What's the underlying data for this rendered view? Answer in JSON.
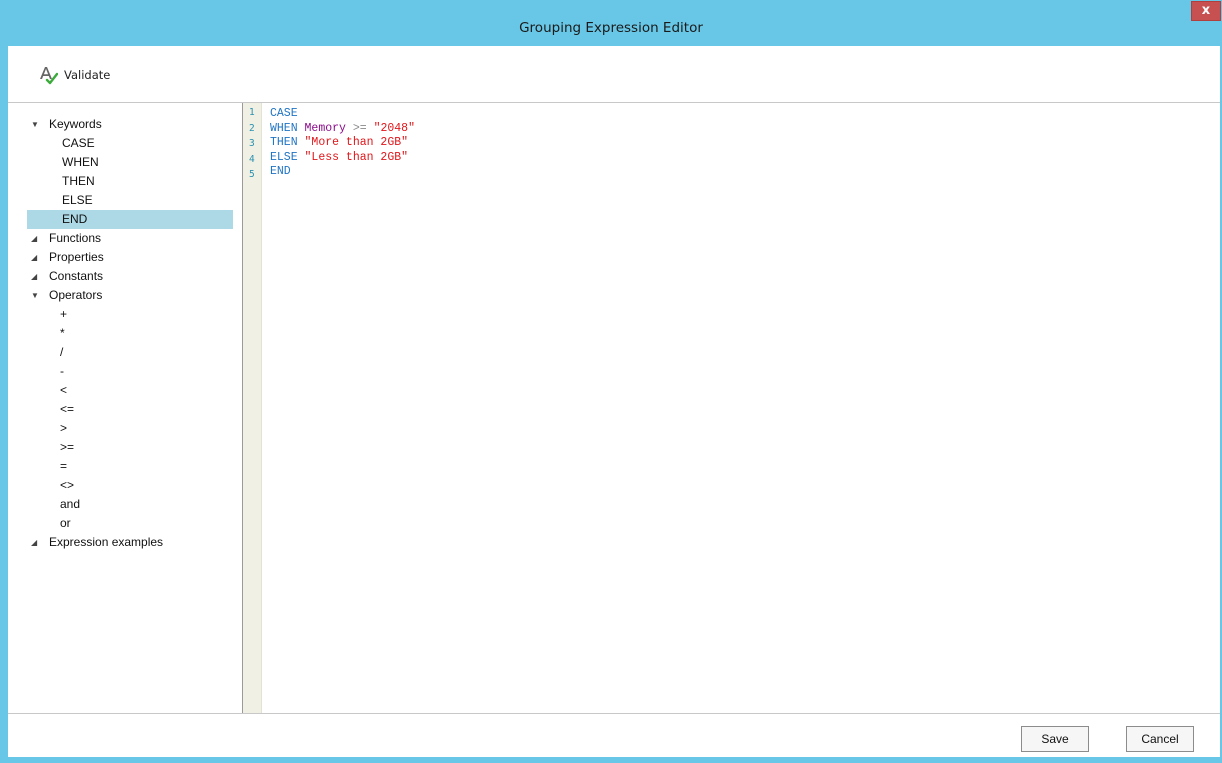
{
  "window": {
    "title": "Grouping Expression Editor",
    "close_glyph": "x"
  },
  "toolbar": {
    "validate_label": "Validate",
    "validate_icon": "spellcheck-icon"
  },
  "tree": {
    "categories": [
      {
        "label": "Keywords",
        "expanded": true,
        "items": [
          "CASE",
          "WHEN",
          "THEN",
          "ELSE",
          "END"
        ],
        "selected_item": "END"
      },
      {
        "label": "Functions",
        "expanded": false
      },
      {
        "label": "Properties",
        "expanded": false
      },
      {
        "label": "Constants",
        "expanded": false
      },
      {
        "label": "Operators",
        "expanded": true,
        "items": [
          "+",
          "*",
          "/",
          "-",
          "<",
          "<=",
          ">",
          ">=",
          "=",
          "<>",
          "and",
          "or"
        ]
      },
      {
        "label": "Expression examples",
        "expanded": false
      }
    ]
  },
  "editor": {
    "line_numbers": [
      "1",
      "2",
      "3",
      "4",
      "5"
    ],
    "lines": [
      [
        {
          "t": "CASE",
          "c": "kw"
        }
      ],
      [
        {
          "t": "WHEN",
          "c": "kw"
        },
        {
          "t": " "
        },
        {
          "t": "Memory",
          "c": "prop"
        },
        {
          "t": " "
        },
        {
          "t": ">=",
          "c": "op"
        },
        {
          "t": " "
        },
        {
          "t": "\"2048\"",
          "c": "str"
        }
      ],
      [
        {
          "t": "THEN",
          "c": "kw"
        },
        {
          "t": " "
        },
        {
          "t": "\"More than 2GB\"",
          "c": "str"
        }
      ],
      [
        {
          "t": "ELSE",
          "c": "kw"
        },
        {
          "t": " "
        },
        {
          "t": "\"Less than 2GB\"",
          "c": "str"
        }
      ],
      [
        {
          "t": "END",
          "c": "kw"
        }
      ]
    ]
  },
  "footer": {
    "save_label": "Save",
    "cancel_label": "Cancel"
  },
  "colors": {
    "titlebar": "#68c7e6",
    "close_button": "#c75050",
    "selection": "#add8e6",
    "keyword": "#1f74c4",
    "property": "#8b0c8b",
    "operator": "#8a8a8a",
    "string": "#e0161a",
    "line_number": "#2b91af"
  }
}
